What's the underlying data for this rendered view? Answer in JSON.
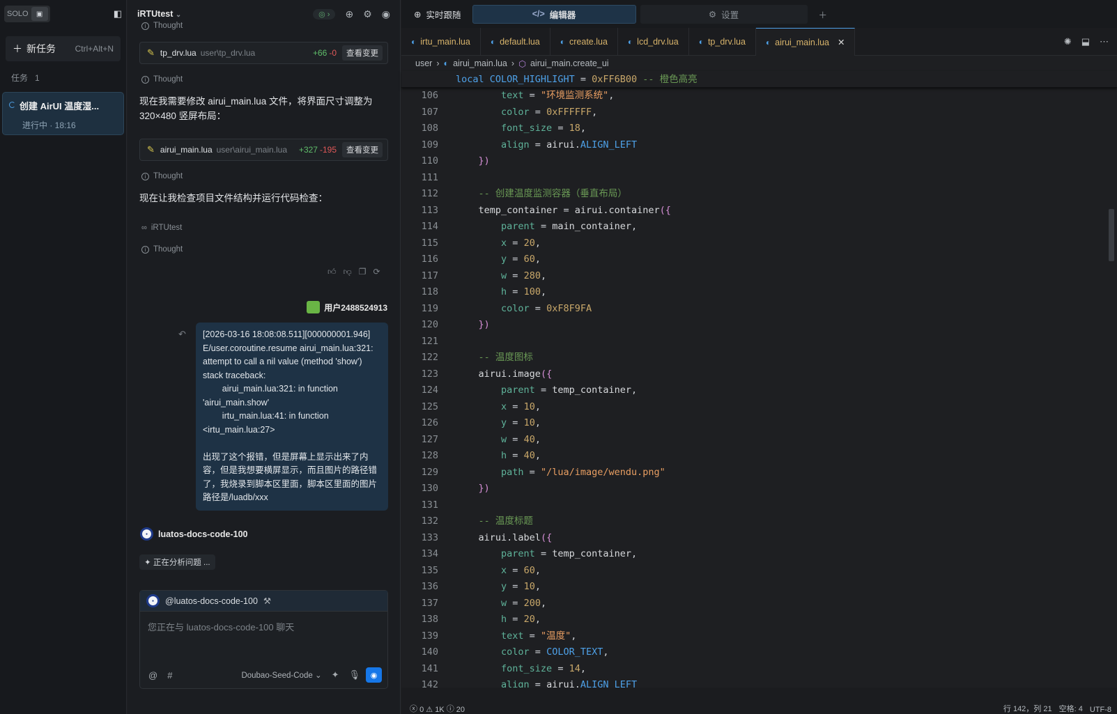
{
  "sidebar": {
    "solo_label": "SOLO",
    "new_task": "新任务",
    "new_task_shortcut": "Ctrl+Alt+N",
    "tasks_label": "任务",
    "tasks_count": "1",
    "task_title": "创建 AirUI 温度湿...",
    "task_status": "进行中 · 18:16"
  },
  "chat": {
    "project": "iRTUtest",
    "top_thought": "Thought",
    "card1": {
      "file": "tp_drv.lua",
      "path": "user\\tp_drv.lua",
      "add": "+66",
      "del": "-0",
      "btn": "查看变更"
    },
    "thought1": "Thought",
    "msg1": "现在我需要修改 airui_main.lua 文件，将界面尺寸调整为 320×480 竖屏布局：",
    "card2": {
      "file": "airui_main.lua",
      "path": "user\\airui_main.lua",
      "add": "+327",
      "del": "-195",
      "btn": "查看变更"
    },
    "thought2": "Thought",
    "msg2": "现在让我检查项目文件结构并运行代码检查：",
    "tool": "iRTUtest",
    "thought3": "Thought",
    "user_name": "用户2488524913",
    "user_msg": "[2026-03-16 18:08:08.511][000000001.946]\nE/user.coroutine.resume airui_main.lua:321:\nattempt to call a nil value (method 'show')\nstack traceback:\n        airui_main.lua:321: in function\n'airui_main.show'\n        irtu_main.lua:41: in function\n<irtu_main.lua:27>\n\n出现了这个报错，但是屏幕上显示出来了内容，但是我想要横屏显示，而且图片的路径错了，我烧录到脚本区里面，脚本区里面的图片路径是/luadb/xxx",
    "agent_name": "luatos-docs-code-100",
    "analyzing": "正在分析问题 ...",
    "composer_mention": "@luatos-docs-code-100",
    "composer_placeholder": "您正在与 luatos-docs-code-100 聊天",
    "model": "Doubao-Seed-Code"
  },
  "editor": {
    "top_tabs": {
      "follow": "实时跟随",
      "editor": "编辑器",
      "settings": "设置"
    },
    "tabs": [
      "irtu_main.lua",
      "default.lua",
      "create.lua",
      "lcd_drv.lua",
      "tp_drv.lua",
      "airui_main.lua"
    ],
    "breadcrumb": {
      "p1": "user",
      "p2": "airui_main.lua",
      "p3": "airui_main.create_ui"
    },
    "sticky": "local COLOR_HIGHLIGHT = 0xFF6B00 -- 橙色高亮",
    "lines": [
      {
        "n": "106",
        "t": "        text = \"环境监测系统\","
      },
      {
        "n": "107",
        "t": "        color = 0xFFFFFF,"
      },
      {
        "n": "108",
        "t": "        font_size = 18,"
      },
      {
        "n": "109",
        "t": "        align = airui.ALIGN_LEFT"
      },
      {
        "n": "110",
        "t": "    })"
      },
      {
        "n": "111",
        "t": ""
      },
      {
        "n": "112",
        "t": "    -- 创建温度监测容器（垂直布局）"
      },
      {
        "n": "113",
        "t": "    temp_container = airui.container({"
      },
      {
        "n": "114",
        "t": "        parent = main_container,"
      },
      {
        "n": "115",
        "t": "        x = 20,"
      },
      {
        "n": "116",
        "t": "        y = 60,"
      },
      {
        "n": "117",
        "t": "        w = 280,"
      },
      {
        "n": "118",
        "t": "        h = 100,"
      },
      {
        "n": "119",
        "t": "        color = 0xF8F9FA"
      },
      {
        "n": "120",
        "t": "    })"
      },
      {
        "n": "121",
        "t": ""
      },
      {
        "n": "122",
        "t": "    -- 温度图标"
      },
      {
        "n": "123",
        "t": "    airui.image({"
      },
      {
        "n": "124",
        "t": "        parent = temp_container,"
      },
      {
        "n": "125",
        "t": "        x = 10,"
      },
      {
        "n": "126",
        "t": "        y = 10,"
      },
      {
        "n": "127",
        "t": "        w = 40,"
      },
      {
        "n": "128",
        "t": "        h = 40,"
      },
      {
        "n": "129",
        "t": "        path = \"/lua/image/wendu.png\""
      },
      {
        "n": "130",
        "t": "    })"
      },
      {
        "n": "131",
        "t": ""
      },
      {
        "n": "132",
        "t": "    -- 温度标题"
      },
      {
        "n": "133",
        "t": "    airui.label({"
      },
      {
        "n": "134",
        "t": "        parent = temp_container,"
      },
      {
        "n": "135",
        "t": "        x = 60,"
      },
      {
        "n": "136",
        "t": "        y = 10,"
      },
      {
        "n": "137",
        "t": "        w = 200,"
      },
      {
        "n": "138",
        "t": "        h = 20,"
      },
      {
        "n": "139",
        "t": "        text = \"温度\","
      },
      {
        "n": "140",
        "t": "        color = COLOR_TEXT,"
      },
      {
        "n": "141",
        "t": "        font_size = 14,"
      },
      {
        "n": "142",
        "t": "        align = airui.ALIGN_LEFT"
      }
    ],
    "status": {
      "errors": "0",
      "warnings": "1K",
      "info": "20",
      "pos": "行 142，列 21",
      "spaces": "空格: 4",
      "enc": "UTF-8"
    }
  }
}
